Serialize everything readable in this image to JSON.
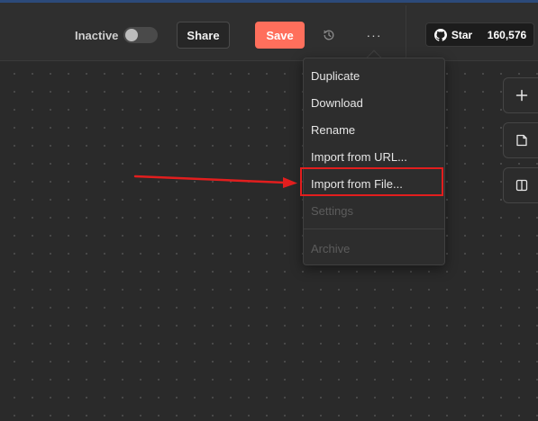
{
  "toolbar": {
    "inactive_label": "Inactive",
    "active_toggle": false,
    "share_label": "Share",
    "save_label": "Save",
    "history_icon": "history-icon",
    "more_icon": "more-horizontal-icon",
    "more_label": "···"
  },
  "github": {
    "star_label": "Star",
    "star_count": "160,576",
    "icon": "github-icon"
  },
  "menu": {
    "items": [
      {
        "label": "Duplicate",
        "disabled": false
      },
      {
        "label": "Download",
        "disabled": false
      },
      {
        "label": "Rename",
        "disabled": false
      },
      {
        "label": "Import from URL...",
        "disabled": false
      },
      {
        "label": "Import from File...",
        "disabled": false,
        "highlighted": true
      },
      {
        "label": "Settings",
        "disabled": true
      },
      {
        "label": "Archive",
        "disabled": true
      }
    ]
  },
  "side_buttons": [
    {
      "icon": "plus-icon"
    },
    {
      "icon": "sticky-note-icon"
    },
    {
      "icon": "panel-toggle-icon"
    }
  ],
  "colors": {
    "save": "#ff6f5c",
    "annotation": "#e21e1e",
    "canvas": "#2a2a2a"
  }
}
